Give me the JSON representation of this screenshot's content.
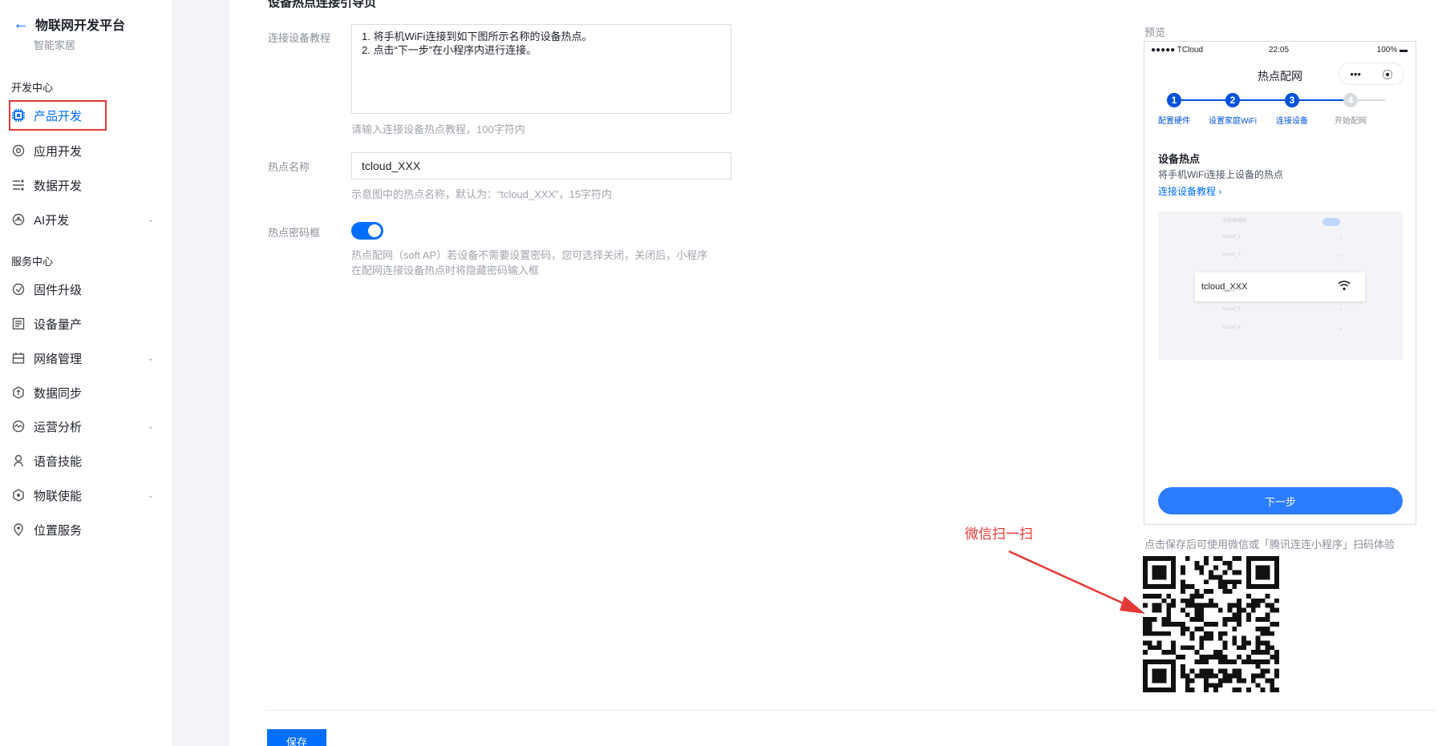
{
  "sidebar": {
    "brand_title": "物联网开发平台",
    "brand_sub": "智能家居",
    "section_dev": "开发中心",
    "section_service": "服务中心",
    "items": [
      {
        "label": "产品开发",
        "icon": "chip-icon",
        "active": true
      },
      {
        "label": "应用开发",
        "icon": "app-icon"
      },
      {
        "label": "数据开发",
        "icon": "data-flow-icon"
      },
      {
        "label": "AI开发",
        "icon": "ai-icon",
        "expandable": true
      },
      {
        "label": "固件升级",
        "icon": "firmware-icon"
      },
      {
        "label": "设备量产",
        "icon": "mass-production-icon"
      },
      {
        "label": "网络管理",
        "icon": "network-icon",
        "expandable": true
      },
      {
        "label": "数据同步",
        "icon": "sync-icon"
      },
      {
        "label": "运营分析",
        "icon": "analytics-icon",
        "expandable": true
      },
      {
        "label": "语音技能",
        "icon": "voice-icon"
      },
      {
        "label": "物联使能",
        "icon": "iot-enable-icon",
        "expandable": true
      },
      {
        "label": "位置服务",
        "icon": "location-icon"
      }
    ]
  },
  "form": {
    "page_heading": "设备热点连接引导页",
    "tutorial_label": "连接设备教程",
    "tutorial_value": "1. 将手机WiFi连接到如下图所示名称的设备热点。\n2. 点击“下一步”在小程序内进行连接。",
    "tutorial_hint": "请输入连接设备热点教程，100字符内",
    "ssid_label": "热点名称",
    "ssid_value": "tcloud_XXX",
    "ssid_hint": "示意图中的热点名称，默认为：“tcloud_XXX”，15字符内",
    "pwd_label": "热点密码框",
    "pwd_hint_1": "热点配网（soft AP）若设备不需要设置密码，您可选择关闭，关闭后，小程序",
    "pwd_hint_2": "在配网连接设备热点时将隐藏密码输入框",
    "save_label": "保存"
  },
  "preview": {
    "label": "预览",
    "status_left": "●●●●● TCloud",
    "status_time": "22:05",
    "status_right": "100% ▬",
    "title": "热点配网",
    "capsule_more": "•••",
    "capsule_close": "⦿",
    "steps": [
      {
        "num": "1",
        "label": "配置硬件",
        "done": true
      },
      {
        "num": "2",
        "label": "设置家庭WiFi",
        "done": true
      },
      {
        "num": "3",
        "label": "连接设备",
        "done": true
      },
      {
        "num": "4",
        "label": "开始配网",
        "done": false
      }
    ],
    "section_title": "设备热点",
    "section_desc": "将手机WiFi连接上设备的热点",
    "section_link": "连接设备教程 ›",
    "wifi_header": "无线局域网",
    "wifi_rows": [
      "tcloud_1",
      "tcloud_2",
      "tcloud_4",
      "tcloud_5",
      "tcloud_6"
    ],
    "wifi_selected": "tcloud_XXX",
    "next_label": "下一步"
  },
  "scan_note": "点击保存后可使用微信或「腾讯连连小程序」扫码体验",
  "annotation": "微信扫一扫",
  "colors": {
    "primary": "#006eff",
    "step": "#0052d9",
    "annot": "#e53935"
  }
}
